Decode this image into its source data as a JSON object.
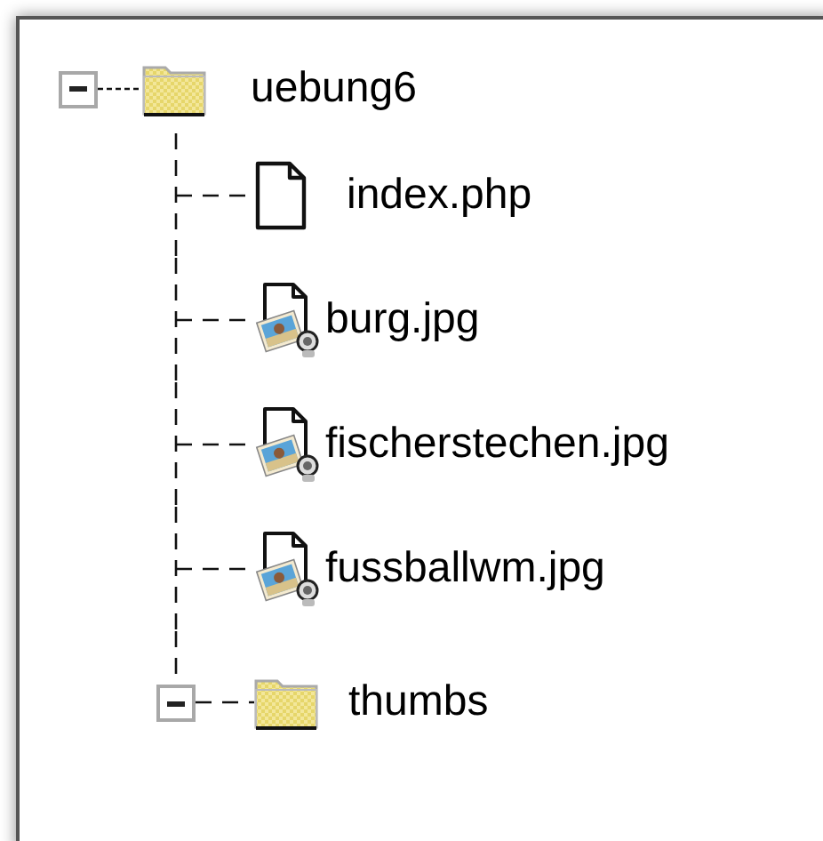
{
  "tree": {
    "label": "uebung6",
    "kind": "folder",
    "expanded": true,
    "children": [
      {
        "label": "index.php",
        "kind": "file"
      },
      {
        "label": "burg.jpg",
        "kind": "image"
      },
      {
        "label": "fischerstechen.jpg",
        "kind": "image"
      },
      {
        "label": "fussballwm.jpg",
        "kind": "image"
      },
      {
        "label": "thumbs",
        "kind": "folder",
        "expanded": true
      }
    ]
  }
}
